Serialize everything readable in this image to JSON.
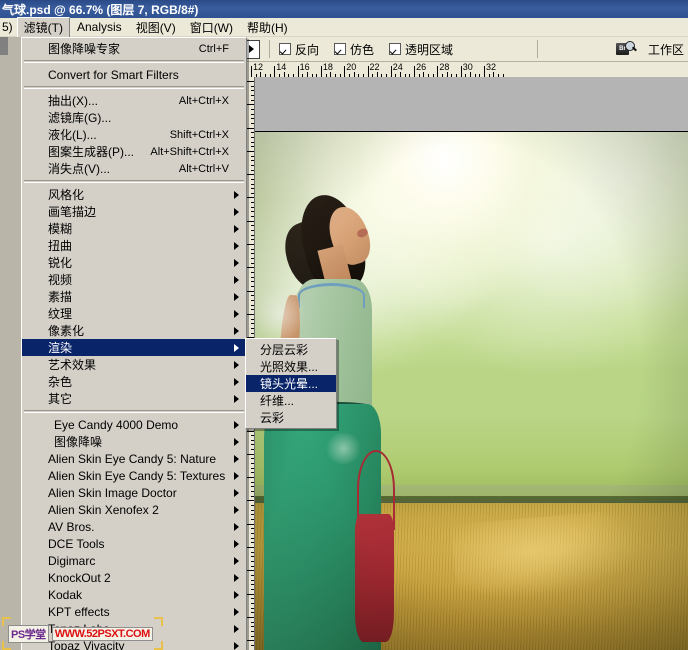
{
  "window": {
    "title": "气球.psd @ 66.7% (图层 7, RGB/8#)"
  },
  "menubar": {
    "items": [
      {
        "label": "5)",
        "state": "clipped"
      },
      {
        "label": "滤镜(T)",
        "state": "open"
      },
      {
        "label": "Analysis",
        "state": "normal"
      },
      {
        "label": "视图(V)",
        "state": "normal"
      },
      {
        "label": "窗口(W)",
        "state": "normal"
      },
      {
        "label": "帮助(H)",
        "state": "normal"
      }
    ]
  },
  "options_bar": {
    "gradient_picker_icon": "triangle-right-icon",
    "checkboxes": [
      {
        "label": "反向",
        "checked": true
      },
      {
        "label": "仿色",
        "checked": true
      },
      {
        "label": "透明区域",
        "checked": true
      }
    ],
    "bridge_icon": "bridge-icon",
    "bridge_badge": "Br",
    "workspace_label": "工作区"
  },
  "ruler": {
    "unit_marks": [
      "12",
      "14",
      "16",
      "18",
      "20",
      "22",
      "24",
      "26",
      "28",
      "30",
      "32"
    ]
  },
  "filter_menu": {
    "groups": [
      {
        "items": [
          {
            "label": "图像降噪专家",
            "accel": "Ctrl+F",
            "submenu": false,
            "selected": false
          }
        ]
      },
      {
        "items": [
          {
            "label": "Convert for Smart Filters",
            "accel": "",
            "submenu": false,
            "selected": false
          }
        ]
      },
      {
        "items": [
          {
            "label": "抽出(X)...",
            "accel": "Alt+Ctrl+X",
            "submenu": false,
            "selected": false
          },
          {
            "label": "滤镜库(G)...",
            "accel": "",
            "submenu": false,
            "selected": false
          },
          {
            "label": "液化(L)...",
            "accel": "Shift+Ctrl+X",
            "submenu": false,
            "selected": false
          },
          {
            "label": "图案生成器(P)...",
            "accel": "Alt+Shift+Ctrl+X",
            "submenu": false,
            "selected": false
          },
          {
            "label": "消失点(V)...",
            "accel": "Alt+Ctrl+V",
            "submenu": false,
            "selected": false
          }
        ]
      },
      {
        "items": [
          {
            "label": "风格化",
            "accel": "",
            "submenu": true,
            "selected": false
          },
          {
            "label": "画笔描边",
            "accel": "",
            "submenu": true,
            "selected": false
          },
          {
            "label": "模糊",
            "accel": "",
            "submenu": true,
            "selected": false
          },
          {
            "label": "扭曲",
            "accel": "",
            "submenu": true,
            "selected": false
          },
          {
            "label": "锐化",
            "accel": "",
            "submenu": true,
            "selected": false
          },
          {
            "label": "视频",
            "accel": "",
            "submenu": true,
            "selected": false
          },
          {
            "label": "素描",
            "accel": "",
            "submenu": true,
            "selected": false
          },
          {
            "label": "纹理",
            "accel": "",
            "submenu": true,
            "selected": false
          },
          {
            "label": "像素化",
            "accel": "",
            "submenu": true,
            "selected": false
          },
          {
            "label": "渲染",
            "accel": "",
            "submenu": true,
            "selected": true
          },
          {
            "label": "艺术效果",
            "accel": "",
            "submenu": true,
            "selected": false
          },
          {
            "label": "杂色",
            "accel": "",
            "submenu": true,
            "selected": false
          },
          {
            "label": "其它",
            "accel": "",
            "submenu": true,
            "selected": false
          }
        ]
      },
      {
        "items": [
          {
            "label": "Eye Candy 4000  Demo",
            "accel": "",
            "submenu": true,
            "selected": false,
            "indent": true
          },
          {
            "label": "图像降噪",
            "accel": "",
            "submenu": true,
            "selected": false,
            "indent": true
          },
          {
            "label": "Alien Skin Eye Candy 5: Nature",
            "accel": "",
            "submenu": true,
            "selected": false
          },
          {
            "label": "Alien Skin Eye Candy 5: Textures",
            "accel": "",
            "submenu": true,
            "selected": false
          },
          {
            "label": "Alien Skin Image Doctor",
            "accel": "",
            "submenu": true,
            "selected": false
          },
          {
            "label": "Alien Skin Xenofex 2",
            "accel": "",
            "submenu": true,
            "selected": false
          },
          {
            "label": "AV Bros.",
            "accel": "",
            "submenu": true,
            "selected": false
          },
          {
            "label": "DCE Tools",
            "accel": "",
            "submenu": true,
            "selected": false
          },
          {
            "label": "Digimarc",
            "accel": "",
            "submenu": true,
            "selected": false
          },
          {
            "label": "KnockOut 2",
            "accel": "",
            "submenu": true,
            "selected": false
          },
          {
            "label": "Kodak",
            "accel": "",
            "submenu": true,
            "selected": false
          },
          {
            "label": "KPT effects",
            "accel": "",
            "submenu": true,
            "selected": false
          },
          {
            "label": "Topaz Labs",
            "accel": "",
            "submenu": true,
            "selected": false
          },
          {
            "label": "Topaz Vivacity",
            "accel": "",
            "submenu": true,
            "selected": false
          }
        ]
      }
    ]
  },
  "render_submenu": {
    "items": [
      {
        "label": "分层云彩",
        "selected": false
      },
      {
        "label": "光照效果...",
        "selected": false
      },
      {
        "label": "镜头光晕...",
        "selected": true
      },
      {
        "label": "纤维...",
        "selected": false
      },
      {
        "label": "云彩",
        "selected": false
      }
    ]
  },
  "watermark": {
    "left": "PS学堂",
    "right": "WWW.52PSXT.COM"
  },
  "colors": {
    "titlebar": "#2e5192",
    "menu_face": "#d4d0c8",
    "menu_highlight": "#0a246a",
    "options_bar": "#ece9d8",
    "canvas_backdrop": "#b4b4b4"
  }
}
